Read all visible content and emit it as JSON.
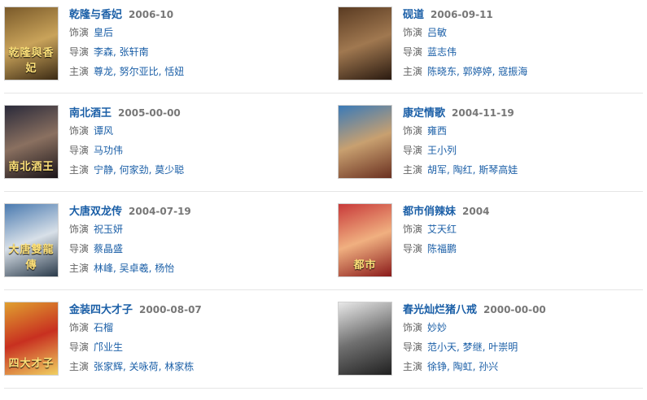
{
  "shows": [
    {
      "title": "乾隆与香妃",
      "date": "2006-10",
      "role_label": "饰演",
      "role": "皇后",
      "director_label": "导演",
      "directors": "李森, 张轩南",
      "cast_label": "主演",
      "cast": "尊龙, 努尔亚比, 恬妞",
      "poster_text": "乾隆與香妃",
      "poster_colors": [
        "#7a5a2a",
        "#c9a35a",
        "#3b2a14"
      ]
    },
    {
      "title": "砚道",
      "date": "2006-09-11",
      "role_label": "饰演",
      "role": "吕敏",
      "director_label": "导演",
      "directors": "蓝志伟",
      "cast_label": "主演",
      "cast": "陈晓东, 郭婷婷, 寇振海",
      "poster_text": "",
      "poster_colors": [
        "#5a3b22",
        "#a07850",
        "#2a1a10"
      ]
    },
    {
      "title": "南北酒王",
      "date": "2005-00-00",
      "role_label": "饰演",
      "role": "谭风",
      "director_label": "导演",
      "directors": "马功伟",
      "cast_label": "主演",
      "cast": "宁静, 何家劲, 莫少聪",
      "poster_text": "南北酒王",
      "poster_colors": [
        "#2a2a3a",
        "#8a7060",
        "#1a1418"
      ]
    },
    {
      "title": "康定情歌",
      "date": "2004-11-19",
      "role_label": "饰演",
      "role": "雍西",
      "director_label": "导演",
      "directors": "王小列",
      "cast_label": "主演",
      "cast": "胡军, 陶红, 斯琴高娃",
      "poster_text": "",
      "poster_colors": [
        "#3a7ab8",
        "#c8a070",
        "#6a3020"
      ]
    },
    {
      "title": "大唐双龙传",
      "date": "2004-07-19",
      "role_label": "饰演",
      "role": "祝玉妍",
      "director_label": "导演",
      "directors": "蔡晶盛",
      "cast_label": "主演",
      "cast": "林峰, 吴卓羲, 杨怡",
      "poster_text": "大唐雙龍傳",
      "poster_colors": [
        "#4a7ab0",
        "#d8e0e8",
        "#2a3a4a"
      ]
    },
    {
      "title": "都市俏辣妹",
      "date": "2004",
      "role_label": "饰演",
      "role": "艾天红",
      "director_label": "导演",
      "directors": "陈福鹏",
      "cast_label": "",
      "cast": "",
      "poster_text": "都市",
      "poster_colors": [
        "#c83a3a",
        "#f0b080",
        "#8a1a1a"
      ]
    },
    {
      "title": "金装四大才子",
      "date": "2000-08-07",
      "role_label": "饰演",
      "role": "石榴",
      "director_label": "导演",
      "directors": "邝业生",
      "cast_label": "主演",
      "cast": "张家辉, 关咏荷, 林家栋",
      "poster_text": "四大才子",
      "poster_colors": [
        "#e0a030",
        "#c83020",
        "#f0d060"
      ]
    },
    {
      "title": "春光灿烂猪八戒",
      "date": "2000-00-00",
      "role_label": "饰演",
      "role": "妙妙",
      "director_label": "导演",
      "directors": "范小天, 梦继, 叶崇明",
      "cast_label": "主演",
      "cast": "徐铮, 陶虹, 孙兴",
      "poster_text": "",
      "poster_colors": [
        "#e8e8e8",
        "#707070",
        "#202020"
      ]
    }
  ]
}
